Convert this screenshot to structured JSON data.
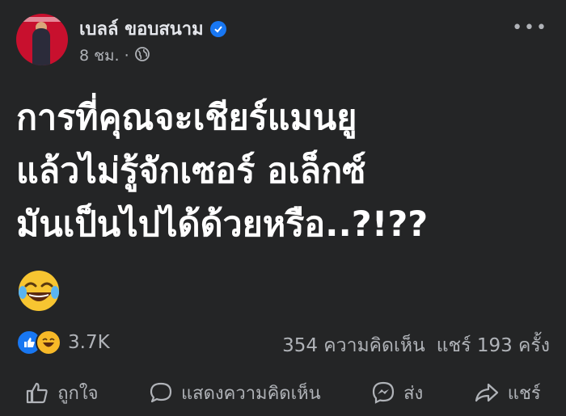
{
  "post": {
    "author": "เบลล์ ขอบสนาม",
    "time": "8 ชม.",
    "separator": "·",
    "text": "การที่คุณจะเชียร์แมนยู\nแล้วไม่รู้จักเซอร์ อเล็กซ์\nมันเป็นไปได้ด้วยหรือ..?!??",
    "emoji": "😂"
  },
  "stats": {
    "reactions": "3.7K",
    "comments": "354 ความคิดเห็น",
    "shares": "แชร์ 193 ครั้ง"
  },
  "actions": {
    "like": "ถูกใจ",
    "comment": "แสดงความคิดเห็น",
    "send": "ส่ง",
    "share": "แชร์"
  },
  "colors": {
    "background": "#242526",
    "text": "#ffffff",
    "secondary": "#b0b3b8",
    "accent": "#1877f2"
  },
  "icons": [
    "verified-badge-icon",
    "globe-icon",
    "more-icon",
    "like-reaction-icon",
    "haha-reaction-icon",
    "thumbs-up-icon",
    "comment-bubble-icon",
    "messenger-icon",
    "share-arrow-icon"
  ]
}
